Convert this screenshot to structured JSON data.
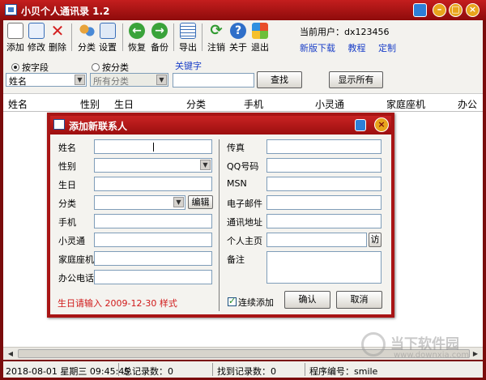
{
  "window": {
    "title": "小贝个人通讯录 1.2"
  },
  "toolbar": {
    "items": [
      {
        "label": "添加",
        "icon": "add-doc-icon"
      },
      {
        "label": "修改",
        "icon": "edit-doc-icon"
      },
      {
        "label": "删除",
        "icon": "delete-x-icon"
      },
      {
        "label": "分类",
        "icon": "people-group-icon"
      },
      {
        "label": "设置",
        "icon": "settings-calendar-icon"
      },
      {
        "label": "恢复",
        "icon": "restore-arrow-icon"
      },
      {
        "label": "备份",
        "icon": "backup-arrow-icon"
      },
      {
        "label": "导出",
        "icon": "export-list-icon"
      },
      {
        "label": "注销",
        "icon": "logout-refresh-icon"
      },
      {
        "label": "关于",
        "icon": "help-question-icon"
      },
      {
        "label": "退出",
        "icon": "exit-windows-icon"
      }
    ],
    "current_user_label": "当前用户：",
    "current_user": "dx123456",
    "links": [
      "新版下载",
      "教程",
      "定制"
    ]
  },
  "search": {
    "radio_field": "按字段",
    "radio_category": "按分类",
    "keyword_label": "关键字",
    "field_select": "姓名",
    "category_select": "所有分类",
    "keyword_value": "",
    "search_button": "查找",
    "show_all_button": "显示所有"
  },
  "grid": {
    "columns": [
      "姓名",
      "性别",
      "生日",
      "分类",
      "手机",
      "小灵通",
      "家庭座机",
      "办公"
    ]
  },
  "status": {
    "datetime": "2018-08-01 星期三 09:45:45",
    "total_records": "总记录数：0",
    "found_records": "找到记录数：0",
    "program_id": "程序编号：smile"
  },
  "watermark": {
    "text": "当下软件园",
    "url": "www.downxia.com"
  },
  "dialog": {
    "title": "添加新联系人",
    "left_fields": [
      {
        "label": "姓名",
        "value": ""
      },
      {
        "label": "性别",
        "value": ""
      },
      {
        "label": "生日",
        "value": ""
      },
      {
        "label": "分类",
        "value": ""
      },
      {
        "label": "手机",
        "value": ""
      },
      {
        "label": "小灵通",
        "value": ""
      },
      {
        "label": "家庭座机",
        "value": ""
      },
      {
        "label": "办公电话",
        "value": ""
      }
    ],
    "right_fields": [
      {
        "label": "传真",
        "value": ""
      },
      {
        "label": "QQ号码",
        "value": ""
      },
      {
        "label": "MSN",
        "value": ""
      },
      {
        "label": "电子邮件",
        "value": ""
      },
      {
        "label": "通讯地址",
        "value": ""
      },
      {
        "label": "个人主页",
        "value": ""
      },
      {
        "label": "备注",
        "value": ""
      }
    ],
    "edit_button": "编辑",
    "visit_button": "访",
    "hint": "生日请输入  2009-12-30  样式",
    "continuous_add": "连续添加",
    "confirm_button": "确认",
    "cancel_button": "取消"
  },
  "colors": {
    "title_red": "#a81515",
    "link_blue": "#1a3fc8",
    "hint_red": "#d01818"
  }
}
